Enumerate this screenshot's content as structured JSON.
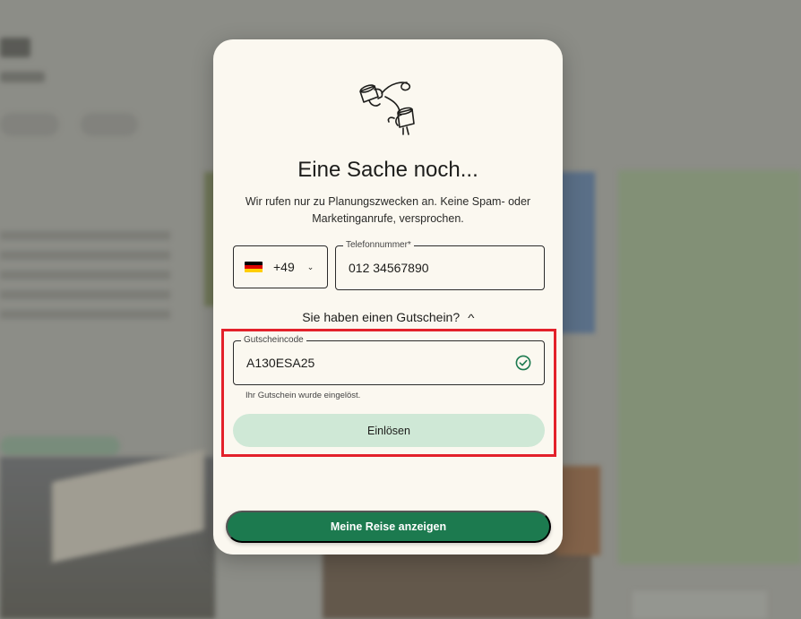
{
  "modal": {
    "title": "Eine Sache noch...",
    "description": "Wir rufen nur zu Planungszwecken an. Keine Spam- oder Marketinganrufe, versprochen.",
    "illustration_icon": "tin-can-telephone-icon"
  },
  "phone": {
    "country_flag": "germany-flag-icon",
    "country_code": "+49",
    "label": "Telefonnummer*",
    "value": "012 34567890"
  },
  "coupon": {
    "toggle_label": "Sie haben einen Gutschein?",
    "label": "Gutscheincode",
    "value": "A130ESA25",
    "status_icon": "check-circle-icon",
    "helper": "Ihr Gutschein wurde eingelöst.",
    "redeem_label": "Einlösen"
  },
  "actions": {
    "primary_label": "Meine Reise anzeigen"
  },
  "colors": {
    "primary": "#1c7a4f",
    "redeem_bg": "#cfe8d6",
    "highlight": "#e3212b",
    "modal_bg": "#fbf8f0"
  }
}
